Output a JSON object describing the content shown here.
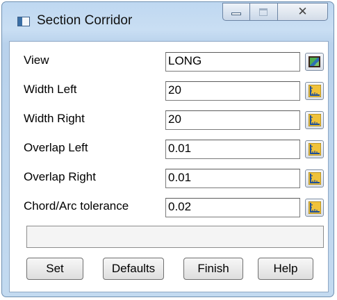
{
  "window": {
    "title": "Section Corridor",
    "close_glyph": "✕"
  },
  "fields": [
    {
      "label": "View",
      "value": "LONG",
      "button_icon": "view-picker-icon"
    },
    {
      "label": "Width Left",
      "value": "20",
      "button_icon": "measure-icon"
    },
    {
      "label": "Width Right",
      "value": "20",
      "button_icon": "measure-icon"
    },
    {
      "label": "Overlap Left",
      "value": "0.01",
      "button_icon": "measure-icon"
    },
    {
      "label": "Overlap Right",
      "value": "0.01",
      "button_icon": "measure-icon"
    },
    {
      "label": "Chord/Arc tolerance",
      "value": "0.02",
      "button_icon": "measure-icon"
    }
  ],
  "status": {
    "message": ""
  },
  "buttons": {
    "set": "Set",
    "defaults": "Defaults",
    "finish": "Finish",
    "help": "Help"
  }
}
